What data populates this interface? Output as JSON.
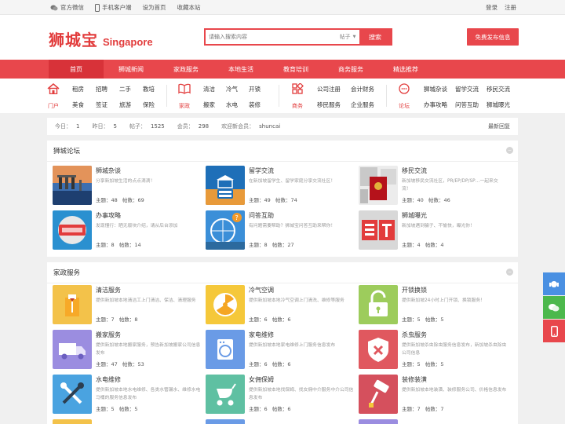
{
  "topbar": {
    "left": [
      "官方微信",
      "手机客户端",
      "设为首页",
      "收藏本站"
    ],
    "login": "登录",
    "register": "注册"
  },
  "header": {
    "logo_cn": "狮城宝",
    "logo_en": "Singapore",
    "search_placeholder": "请输入搜索内容",
    "search_type": "帖子",
    "search_button": "搜索",
    "post_button": "免费发布信息"
  },
  "nav": [
    "首页",
    "狮城新闻",
    "家政服务",
    "本地生活",
    "教育培训",
    "商务服务",
    "精选推荐"
  ],
  "categories": [
    {
      "name": "门户",
      "icon": "home-icon",
      "links": [
        "租房",
        "招聘",
        "二手",
        "教培",
        "美食",
        "签证",
        "旅游",
        "保险"
      ]
    },
    {
      "name": "家政",
      "icon": "book-icon",
      "links": [
        "清洁",
        "冷气",
        "开锁",
        "搬家",
        "水电",
        "装修"
      ]
    },
    {
      "name": "商务",
      "icon": "grid-icon",
      "links": [
        "公司注册",
        "会计财务",
        "移民服务",
        "企业服务"
      ]
    },
    {
      "name": "论坛",
      "icon": "chat-icon",
      "links": [
        "狮城杂谈",
        "留学交流",
        "移民交流",
        "办事攻略",
        "问答互助",
        "狮城曝光"
      ]
    }
  ],
  "stats": {
    "today_label": "今日：",
    "today": "1",
    "yesterday_label": "昨日：",
    "yesterday": "5",
    "posts_label": "帖子：",
    "posts": "1525",
    "members_label": "会员：",
    "members": "298",
    "welcome_label": "欢迎新会员：",
    "welcome": "shuncai",
    "latest_reply": "最新回复"
  },
  "forum": {
    "title": "狮城论坛",
    "items": [
      {
        "title": "狮城杂谈",
        "desc": "分享新加坡生活的点点滴滴！",
        "topics": "主题：48",
        "posts": "帖数：69"
      },
      {
        "title": "留学交流",
        "desc": "在新加坡留学生、留学家庭分享交流社区！",
        "topics": "主题：49",
        "posts": "帖数：74"
      },
      {
        "title": "移民交流",
        "desc": "新加坡移民交流社区，PR/EP/DP/SP…一起来交流！",
        "topics": "主题：40",
        "posts": "帖数：46"
      },
      {
        "title": "办事攻略",
        "desc": "发现懂行：晒无版块介绍，请从后台添加",
        "topics": "主题：8",
        "posts": "帖数：14"
      },
      {
        "title": "问答互助",
        "desc": "有问题需要帮助？狮城宝问答互助来帮你！",
        "topics": "主题：8",
        "posts": "帖数：27"
      },
      {
        "title": "狮城曝光",
        "desc": "新加坡遇到骗子、不愉快，曝光你！",
        "topics": "主题：4",
        "posts": "帖数：4"
      }
    ]
  },
  "housekeeping": {
    "title": "家政服务",
    "items": [
      {
        "title": "清洁服务",
        "desc": "提供新加坡本地清洁工上门清洁、保洁、清理服务",
        "topics": "主题：7",
        "posts": "帖数：8",
        "icon": "cleaning-icon",
        "color": "#f3c24a"
      },
      {
        "title": "冷气空调",
        "desc": "提供新加坡本地冷气空调上门清洗、维修等服务",
        "topics": "主题：6",
        "posts": "帖数：6",
        "icon": "aircon-icon",
        "color": "#f5c83a"
      },
      {
        "title": "开锁换锁",
        "desc": "提供新加坡24小时上门开锁、换锁服务！",
        "topics": "主题：5",
        "posts": "帖数：5",
        "icon": "lock-icon",
        "color": "#9dcc5c"
      },
      {
        "title": "搬家服务",
        "desc": "提供新加坡本地搬家服务，预告新加坡搬家公司信息发布",
        "topics": "主题：47",
        "posts": "帖数：53",
        "icon": "truck-icon",
        "color": "#9b8de0"
      },
      {
        "title": "家电维修",
        "desc": "提供新加坡本地家电维修上门服务信息发布",
        "topics": "主题：6",
        "posts": "帖数：6",
        "icon": "appliance-icon",
        "color": "#6a9be6"
      },
      {
        "title": "杀虫服务",
        "desc": "提供新加坡杀虫除虫服务信息发布，新加坡杀虫除虫公司信息",
        "topics": "主题：5",
        "posts": "帖数：5",
        "icon": "pest-icon",
        "color": "#e0585f"
      },
      {
        "title": "水电维修",
        "desc": "提供新加坡本地水电维修、各类水管漏水、维修水电马桶的服务信息发布",
        "topics": "主题：5",
        "posts": "帖数：5",
        "icon": "tools-icon",
        "color": "#4aa3e0"
      },
      {
        "title": "女佣保姆",
        "desc": "提供新加坡本地找保姆、找女佣中介服务中介公司信息发布",
        "topics": "主题：6",
        "posts": "帖数：6",
        "icon": "stroller-icon",
        "color": "#5fc0a2"
      },
      {
        "title": "装修装潢",
        "desc": "提供新加坡本地装潢、装修服务公司、价格信息发布",
        "topics": "主题：7",
        "posts": "帖数：7",
        "icon": "paint-icon",
        "color": "#d5505d"
      }
    ]
  },
  "side": {
    "colors": [
      "#4a90e2",
      "#4cb84c",
      "#e8474c"
    ]
  }
}
